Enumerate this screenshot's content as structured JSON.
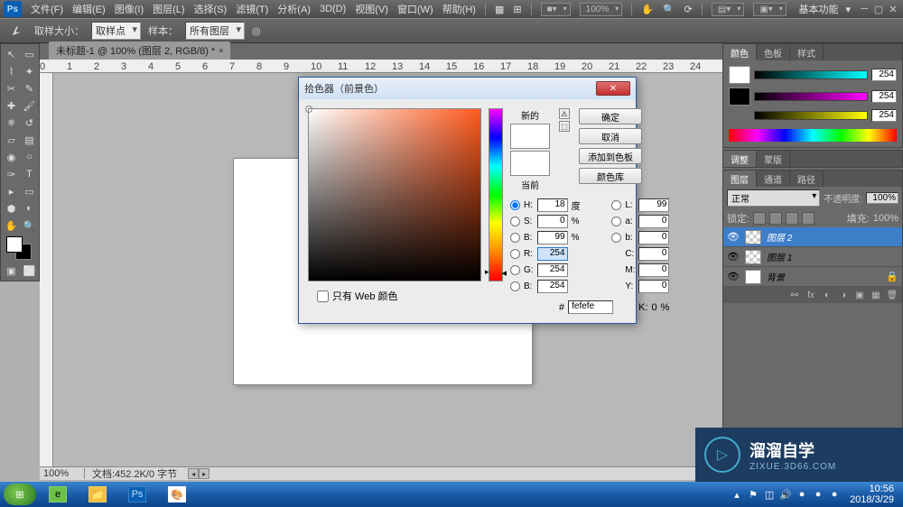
{
  "menubar": {
    "items": [
      "文件(F)",
      "编辑(E)",
      "图像(I)",
      "图层(L)",
      "选择(S)",
      "滤镜(T)",
      "分析(A)",
      "3D(D)",
      "视图(V)",
      "窗口(W)",
      "帮助(H)"
    ],
    "zoom_dd": "100%",
    "workspace": "基本功能"
  },
  "options": {
    "label_sample_size": "取样大小：",
    "sample_size": "取样点",
    "label_sample_layers": "样本：",
    "sample_layers": "所有图层"
  },
  "doc": {
    "tab_title": "未标题-1 @ 100% (图层 2, RGB/8) *",
    "zoom": "100%",
    "docinfo": "文档:452.2K/0 字节"
  },
  "ruler_marks": [
    0,
    1,
    2,
    3,
    4,
    5,
    6,
    7,
    8,
    9,
    10,
    11,
    12,
    13,
    14,
    15,
    16,
    17,
    18,
    19,
    20,
    21,
    22,
    23,
    24
  ],
  "panels": {
    "color": {
      "tabs": [
        "颜色",
        "色板",
        "样式"
      ],
      "vals": [
        "254",
        "254",
        "254"
      ]
    },
    "adjust_tabs": [
      "调整",
      "蒙版"
    ],
    "layers": {
      "tabs": [
        "图层",
        "通道",
        "路径"
      ],
      "mode": "正常",
      "opacity_lbl": "不透明度:",
      "opacity": "100%",
      "lock_lbl": "锁定:",
      "fill_lbl": "填充:",
      "fill": "100%",
      "items": [
        {
          "name": "图层 2",
          "active": true
        },
        {
          "name": "图层 1",
          "active": false
        },
        {
          "name": "背景",
          "active": false,
          "bg": true
        }
      ]
    }
  },
  "picker": {
    "title": "拾色器（前景色）",
    "new_lbl": "新的",
    "current_lbl": "当前",
    "btn_ok": "确定",
    "btn_cancel": "取消",
    "btn_add": "添加到色板",
    "btn_lib": "颜色库",
    "webonly": "只有 Web 颜色",
    "vals": {
      "H": "18",
      "S": "0",
      "B": "99",
      "R": "254",
      "G": "254",
      "Bb": "254",
      "L": "99",
      "a": "0",
      "b": "0",
      "C": "0",
      "M": "0",
      "Y": "0",
      "K": "0",
      "hex": "fefefe"
    },
    "units": {
      "deg": "度",
      "pct": "%"
    }
  },
  "watermark": {
    "big": "溜溜自学",
    "small": "ZIXUE.3D66.COM"
  },
  "taskbar": {
    "time": "10:56",
    "date": "2018/3/29"
  }
}
